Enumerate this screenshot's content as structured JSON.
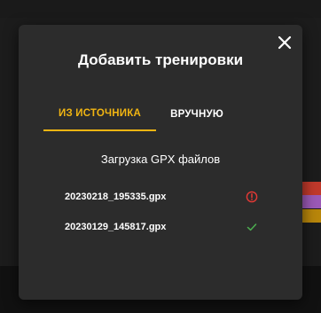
{
  "modal": {
    "title": "Добавить тренировки",
    "tabs": [
      {
        "label": "ИЗ ИСТОЧНИКА",
        "active": true
      },
      {
        "label": "ВРУЧНУЮ",
        "active": false
      }
    ],
    "subtitle": "Загрузка GPX файлов",
    "files": [
      {
        "name": "20230218_195335.gpx",
        "status": "error",
        "status_icon": "error-circle-icon"
      },
      {
        "name": "20230129_145817.gpx",
        "status": "success",
        "status_icon": "check-icon"
      }
    ],
    "close_icon": "close-icon"
  },
  "colors": {
    "accent": "#f1b512",
    "error": "#e53935",
    "success": "#4caf50",
    "modal_bg": "#2c2c2c"
  }
}
